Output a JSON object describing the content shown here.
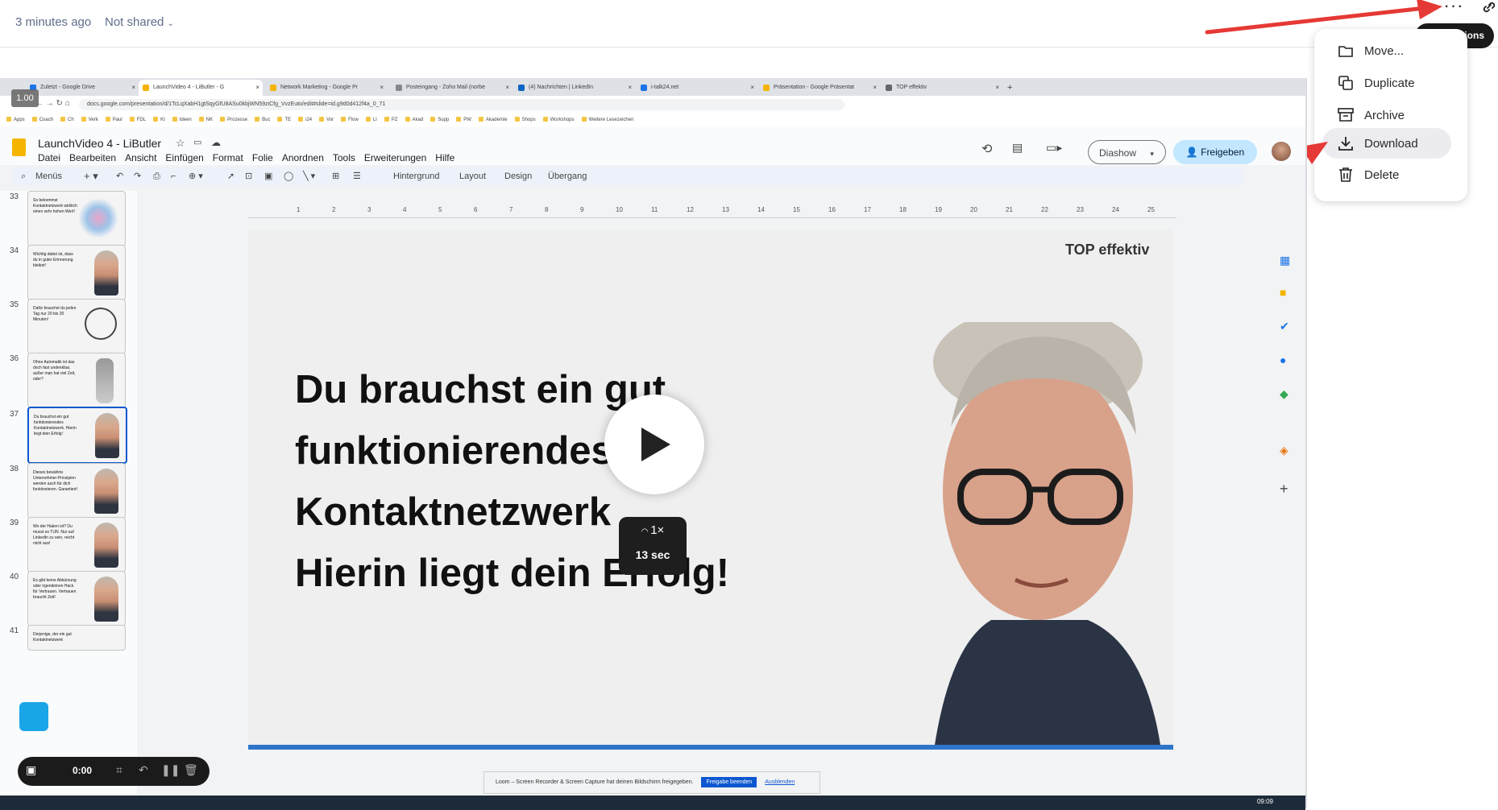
{
  "header": {
    "time_label": "3 minutes ago",
    "share_label": "Not shared",
    "more_label": "···",
    "tooltip": "More actions"
  },
  "menu": {
    "items": [
      {
        "label": "Move...",
        "icon": "folder-icon"
      },
      {
        "label": "Duplicate",
        "icon": "duplicate-icon"
      },
      {
        "label": "Archive",
        "icon": "archive-icon"
      },
      {
        "label": "Download",
        "icon": "download-icon"
      },
      {
        "label": "Delete",
        "icon": "trash-icon"
      }
    ]
  },
  "recording": {
    "speed_badge": "1.00",
    "browser": {
      "tabs": [
        {
          "label": "Zuletzt - Google Drive",
          "color": "#1a73e8"
        },
        {
          "label": "LaunchVideo 4 - LiButler - G",
          "color": "#f4b400"
        },
        {
          "label": "Network Marketing - Google Pr",
          "color": "#f4b400"
        },
        {
          "label": "Posteingang - Zoho Mail (norbe",
          "color": "#888888"
        },
        {
          "label": "(4) Nachrichten | LinkedIn",
          "color": "#0a66c2"
        },
        {
          "label": "i-talk24.net",
          "color": "#1a73e8"
        },
        {
          "label": "Präsentation - Google Präsentat",
          "color": "#f4b400"
        },
        {
          "label": "TOP effektiv",
          "color": "#666666"
        }
      ],
      "url": "docs.google.com/presentation/d/1TcLqXabH1gtSqyGfU8ASu0kbjWN59ziCfg_VvzEuto/edit#slide=id.g9d0d412f4a_0_71",
      "bookmarks": [
        "Apps",
        "Coach",
        "Ch",
        "Verk",
        "Paul",
        "FDL",
        "KI",
        "Ideen",
        "NK",
        "Prozesse",
        "Buc",
        "TE",
        "i24",
        "Vor",
        "Flow",
        "LI",
        "PZ",
        "Akad",
        "Supp",
        "PW",
        "Akademie",
        "Shops",
        "Workshops",
        "Weitere Lesezeichen"
      ]
    },
    "app": {
      "title": "LaunchVideo 4 - LiButler",
      "menus": [
        "Datei",
        "Bearbeiten",
        "Ansicht",
        "Einfügen",
        "Format",
        "Folie",
        "Anordnen",
        "Tools",
        "Erweiterungen",
        "Hilfe"
      ],
      "diashow": "Diashow",
      "share": "Freigeben",
      "toolbar": {
        "menus_label": "Menüs",
        "background": "Hintergrund",
        "layout": "Layout",
        "design": "Design",
        "transition": "Übergang"
      }
    },
    "thumbnails": [
      {
        "num": "33",
        "text": "So bekommst Kontaktnetzwerk wirklich einen sehr hohen Wert!"
      },
      {
        "num": "34",
        "text": "Wichtig dabei ist, dass du in guter Erinnerung bleibst!"
      },
      {
        "num": "35",
        "text": "Dafür brauchst du jeden Tag nur 20 bis 30 Minuten!"
      },
      {
        "num": "36",
        "text": "Ohne Automatik ist das doch fast undenkbar, außer man hat viel Zeit, oder?"
      },
      {
        "num": "37",
        "text": "Du brauchst ein gut funktionierendes Kontaktnetzwerk. Hierin liegt dein Erfolg!"
      },
      {
        "num": "38",
        "text": "Dieses bewährte Unternehmer-Prinzipien werden auch für dich funktionieren. Garantiert!"
      },
      {
        "num": "39",
        "text": "Wo der Haken ist? Du musst es TUN. Nur auf LinkedIn zu sein, reicht nicht aus!"
      },
      {
        "num": "40",
        "text": "Es gibt keine Abkürzung oder irgendeinen Hack für Vertrauen. Vertrauen braucht Zeit!"
      },
      {
        "num": "41",
        "text": "Derjenige, der ein gut Kontaktnetzwerk"
      }
    ],
    "ruler_numbers": [
      "1",
      "2",
      "3",
      "4",
      "5",
      "6",
      "7",
      "8",
      "9",
      "10",
      "11",
      "12",
      "13",
      "14",
      "15",
      "16",
      "17",
      "18",
      "19",
      "20",
      "21",
      "22",
      "23",
      "24",
      "25"
    ],
    "slide": {
      "brand": "TOP effektiv",
      "lines": [
        "Du brauchst ein gut",
        "funktionierendes",
        "Kontaktnetzwerk",
        "Hierin liegt dein Erfolg!"
      ]
    },
    "player": {
      "speed": "1×",
      "remaining": "13 sec",
      "rec_time": "0:00"
    },
    "notification": {
      "text": "Loom – Screen Recorder & Screen Capture hat deinen Bildschirm freigegeben.",
      "stop": "Freigabe beenden",
      "hide": "Ausblenden"
    },
    "clock": "09:09"
  }
}
